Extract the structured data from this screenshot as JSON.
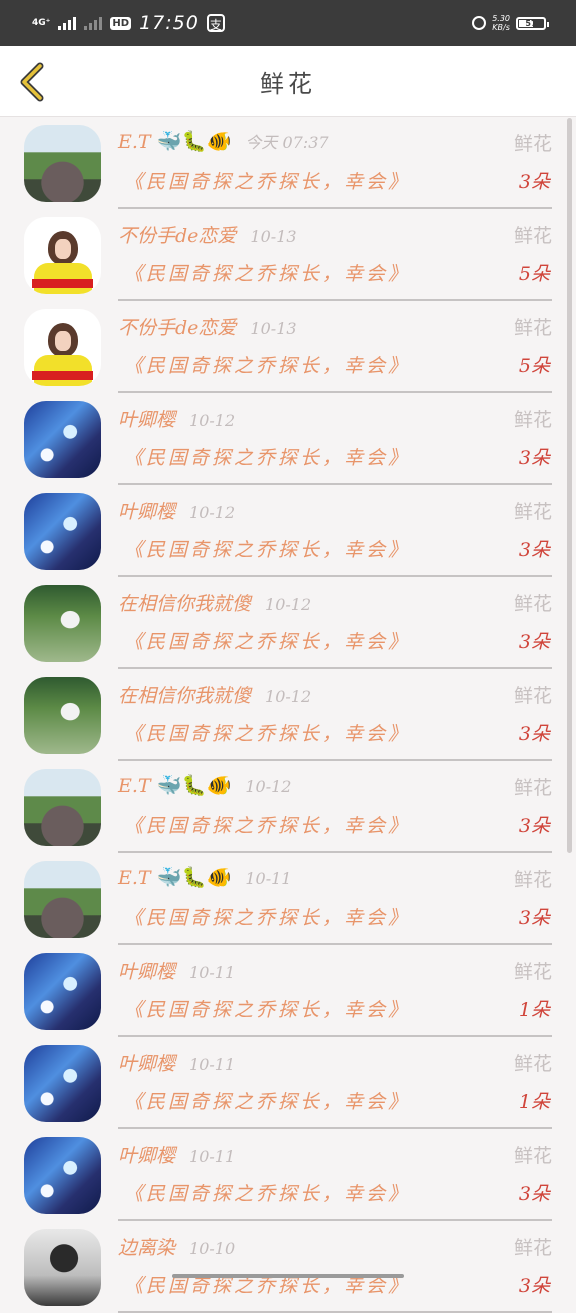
{
  "statusbar": {
    "network": "4G⁺",
    "hd": "HD",
    "time": "17:50",
    "pay_icon": "支",
    "speed_value": "5.30",
    "speed_unit": "KB/s",
    "battery": "57"
  },
  "header": {
    "title": "鲜花",
    "back_icon": "chevron-left-icon",
    "back_color": "#e6c23a"
  },
  "colors": {
    "name": "#e8956a",
    "quantity": "#d0453b",
    "date": "#c3bcbc"
  },
  "entries": [
    {
      "avatar": "scenery",
      "name": "E.T",
      "emojis": "🐳🐛🐠",
      "date": "今天 07:37",
      "gift": "鲜花",
      "book": "《民国奇探之乔探长，幸会》",
      "qty": "3朵"
    },
    {
      "avatar": "girl",
      "name": "不份手de恋爱",
      "emojis": "",
      "date": "10-13",
      "gift": "鲜花",
      "book": "《民国奇探之乔探长，幸会》",
      "qty": "5朵"
    },
    {
      "avatar": "girl",
      "name": "不份手de恋爱",
      "emojis": "",
      "date": "10-13",
      "gift": "鲜花",
      "book": "《民国奇探之乔探长，幸会》",
      "qty": "5朵"
    },
    {
      "avatar": "anime",
      "name": "叶卿樱",
      "emojis": "",
      "date": "10-12",
      "gift": "鲜花",
      "book": "《民国奇探之乔探长，幸会》",
      "qty": "3朵"
    },
    {
      "avatar": "anime",
      "name": "叶卿樱",
      "emojis": "",
      "date": "10-12",
      "gift": "鲜花",
      "book": "《民国奇探之乔探长，幸会》",
      "qty": "3朵"
    },
    {
      "avatar": "garden",
      "name": "在相信你我就傻",
      "emojis": "",
      "date": "10-12",
      "gift": "鲜花",
      "book": "《民国奇探之乔探长，幸会》",
      "qty": "3朵"
    },
    {
      "avatar": "garden",
      "name": "在相信你我就傻",
      "emojis": "",
      "date": "10-12",
      "gift": "鲜花",
      "book": "《民国奇探之乔探长，幸会》",
      "qty": "3朵"
    },
    {
      "avatar": "scenery",
      "name": "E.T",
      "emojis": "🐳🐛🐠",
      "date": "10-12",
      "gift": "鲜花",
      "book": "《民国奇探之乔探长，幸会》",
      "qty": "3朵"
    },
    {
      "avatar": "scenery",
      "name": "E.T",
      "emojis": "🐳🐛🐠",
      "date": "10-11",
      "gift": "鲜花",
      "book": "《民国奇探之乔探长，幸会》",
      "qty": "3朵"
    },
    {
      "avatar": "anime",
      "name": "叶卿樱",
      "emojis": "",
      "date": "10-11",
      "gift": "鲜花",
      "book": "《民国奇探之乔探长，幸会》",
      "qty": "1朵"
    },
    {
      "avatar": "anime",
      "name": "叶卿樱",
      "emojis": "",
      "date": "10-11",
      "gift": "鲜花",
      "book": "《民国奇探之乔探长，幸会》",
      "qty": "1朵"
    },
    {
      "avatar": "anime",
      "name": "叶卿樱",
      "emojis": "",
      "date": "10-11",
      "gift": "鲜花",
      "book": "《民国奇探之乔探长，幸会》",
      "qty": "3朵"
    },
    {
      "avatar": "bw",
      "name": "边离染",
      "emojis": "",
      "date": "10-10",
      "gift": "鲜花",
      "book": "《民国奇探之乔探长，幸会》",
      "qty": "3朵"
    }
  ]
}
